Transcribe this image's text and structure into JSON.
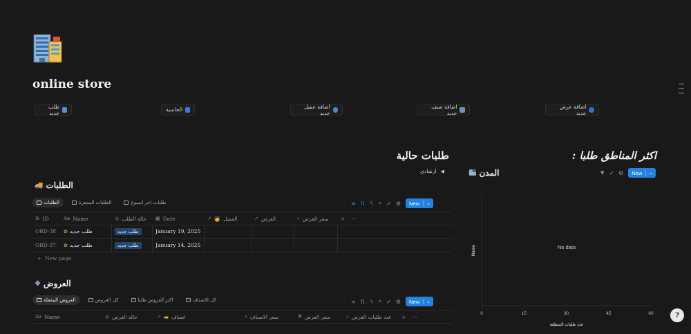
{
  "page": {
    "title": "online store",
    "cover_icon": "office-building-icon"
  },
  "quick_actions": [
    {
      "label": "طلب جديد",
      "icon": "building-icon"
    },
    {
      "label": "الحاسبة",
      "icon": "calculator-icon"
    },
    {
      "label": "اضافة عميل جديد",
      "icon": "person-icon"
    },
    {
      "label": "اضافة صنف جديد",
      "icon": "box-icon"
    },
    {
      "label": "اضافة عرض جديد",
      "icon": "info-icon"
    }
  ],
  "left_section": {
    "heading": "طلبات حالية",
    "toggle_label": "ارشادي"
  },
  "orders_db": {
    "title": "الطلبات",
    "tabs": [
      "الطلبات",
      "الطلبات المنجزة",
      "طلبات اخر اسبوع"
    ],
    "new_button": "New",
    "columns": [
      "ID",
      "Name",
      "حالة الطلب",
      "Date",
      "العميل",
      "العرض",
      "سعر العرض"
    ],
    "rows": [
      {
        "id": "ORD-38",
        "name": "طلب جديد",
        "status": "طلب جديد",
        "date": "January 19, 2025"
      },
      {
        "id": "ORD-37",
        "name": "طلب جديد",
        "status": "طلب جديد",
        "date": "January 14, 2025"
      }
    ],
    "new_page": "New page"
  },
  "offers_db": {
    "title": "العروض",
    "tabs": [
      "العروض المفعلة",
      "كل العروض",
      "اكثر العروض طلبا",
      "كل الاصناف"
    ],
    "new_button": "New",
    "columns": [
      "Name",
      "حالة العرض",
      "اصناف",
      "سعر الاصناف",
      "سعر العرض",
      "عدد طلبات العرض"
    ]
  },
  "right_section": {
    "heading": "اكثر المناطق طلبا :",
    "db_title": "المدن",
    "new_button": "New"
  },
  "chart_data": {
    "type": "bar",
    "categories": [],
    "values": [],
    "empty_text": "No data",
    "xlabel": "عدد طلبات المنطقة",
    "ylabel": "Name",
    "x_ticks": [
      "0",
      "15",
      "30",
      "45",
      "60"
    ],
    "xlim": [
      0,
      60
    ],
    "orientation": "horizontal"
  },
  "help_button": "?"
}
